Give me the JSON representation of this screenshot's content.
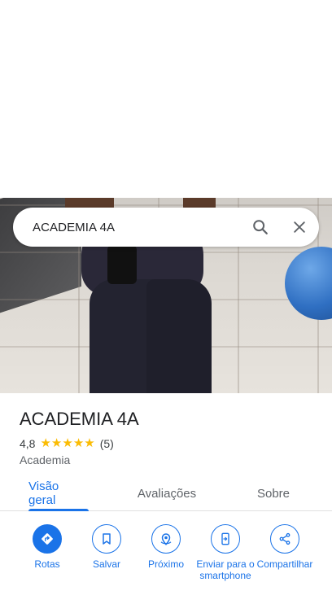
{
  "search": {
    "query": "ACADEMIA 4A"
  },
  "place": {
    "name": "ACADEMIA 4A",
    "rating": "4,8",
    "stars": 5,
    "review_count": "(5)",
    "category": "Academia"
  },
  "tabs": [
    {
      "label": "Visão geral",
      "active": true
    },
    {
      "label": "Avaliações",
      "active": false
    },
    {
      "label": "Sobre",
      "active": false
    }
  ],
  "actions": [
    {
      "label": "Rotas",
      "icon": "directions-icon"
    },
    {
      "label": "Salvar",
      "icon": "bookmark-icon"
    },
    {
      "label": "Próximo",
      "icon": "nearby-icon"
    },
    {
      "label": "Enviar para o smartphone",
      "icon": "send-to-phone-icon"
    },
    {
      "label": "Compartilhar",
      "icon": "share-icon"
    }
  ],
  "colors": {
    "accent": "#1a73e8",
    "star": "#fbbc04",
    "text": "#202124",
    "secondary": "#5f6368"
  }
}
